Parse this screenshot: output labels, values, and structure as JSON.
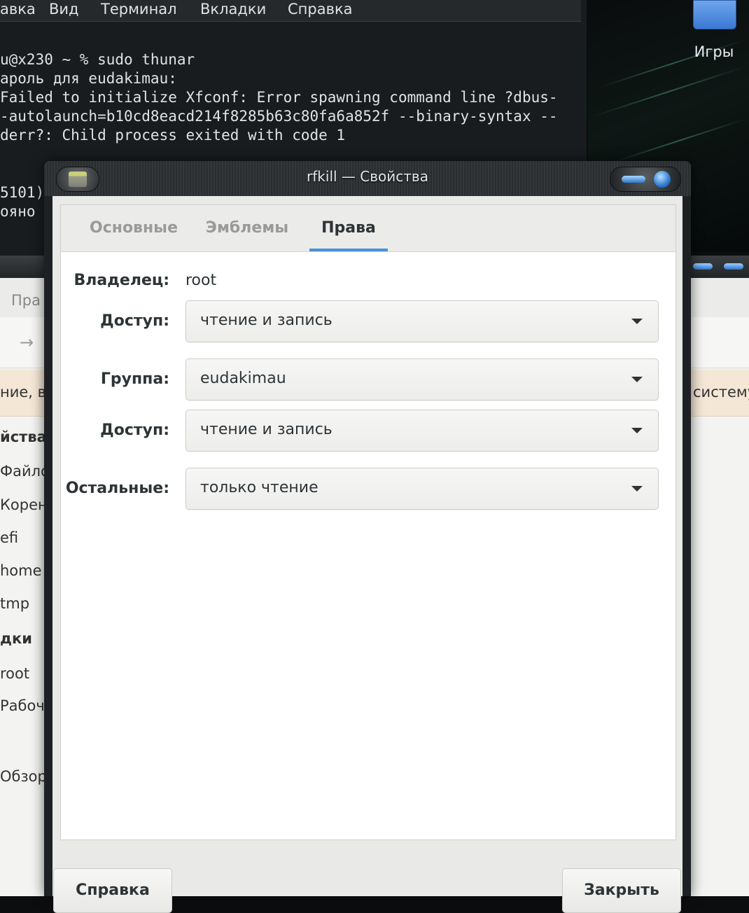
{
  "desktop": {
    "icon_label": "Игры"
  },
  "terminal": {
    "menu": [
      "авка",
      "Вид",
      "Терминал",
      "Вкладки",
      "Справка"
    ],
    "lines": [
      "u@x230 ~ % sudo thunar",
      "ароль для eudakimau:",
      "Failed to initialize Xfconf: Error spawning command line ?dbus-",
      "-autolaunch=b10cd8eacd214f8285b63c80fa6a852f --binary-syntax --",
      "derr?: Child process exited with code 1",
      "",
      "",
      "5101)",
      "ояно"
    ]
  },
  "thunar": {
    "menu_partial": "Пра",
    "toolbar_arrow": "→",
    "infobar_left": "ние, в",
    "infobar_right": "систему",
    "sidebar": [
      "йства",
      "Файло",
      "Корен",
      "efi",
      "home",
      "tmp",
      "дки",
      "root",
      "Рабоч",
      "Обзор"
    ]
  },
  "dialog": {
    "title": "rfkill — Свойства",
    "tabs": [
      "Основные",
      "Эмблемы",
      "Права"
    ],
    "active_tab": "Права",
    "owner_label": "Владелец:",
    "owner_value": "root",
    "owner_access_label": "Доступ:",
    "owner_access_value": "чтение и запись",
    "group_label": "Группа:",
    "group_value": "eudakimau",
    "group_access_label": "Доступ:",
    "group_access_value": "чтение и запись",
    "others_label": "Остальные:",
    "others_value": "только чтение",
    "help_button": "Справка",
    "close_button": "Закрыть"
  },
  "colors": {
    "tab_accent": "#4a90d9",
    "terminal_bg": "#181c1f",
    "infobar_bg": "#f4e7d6"
  }
}
